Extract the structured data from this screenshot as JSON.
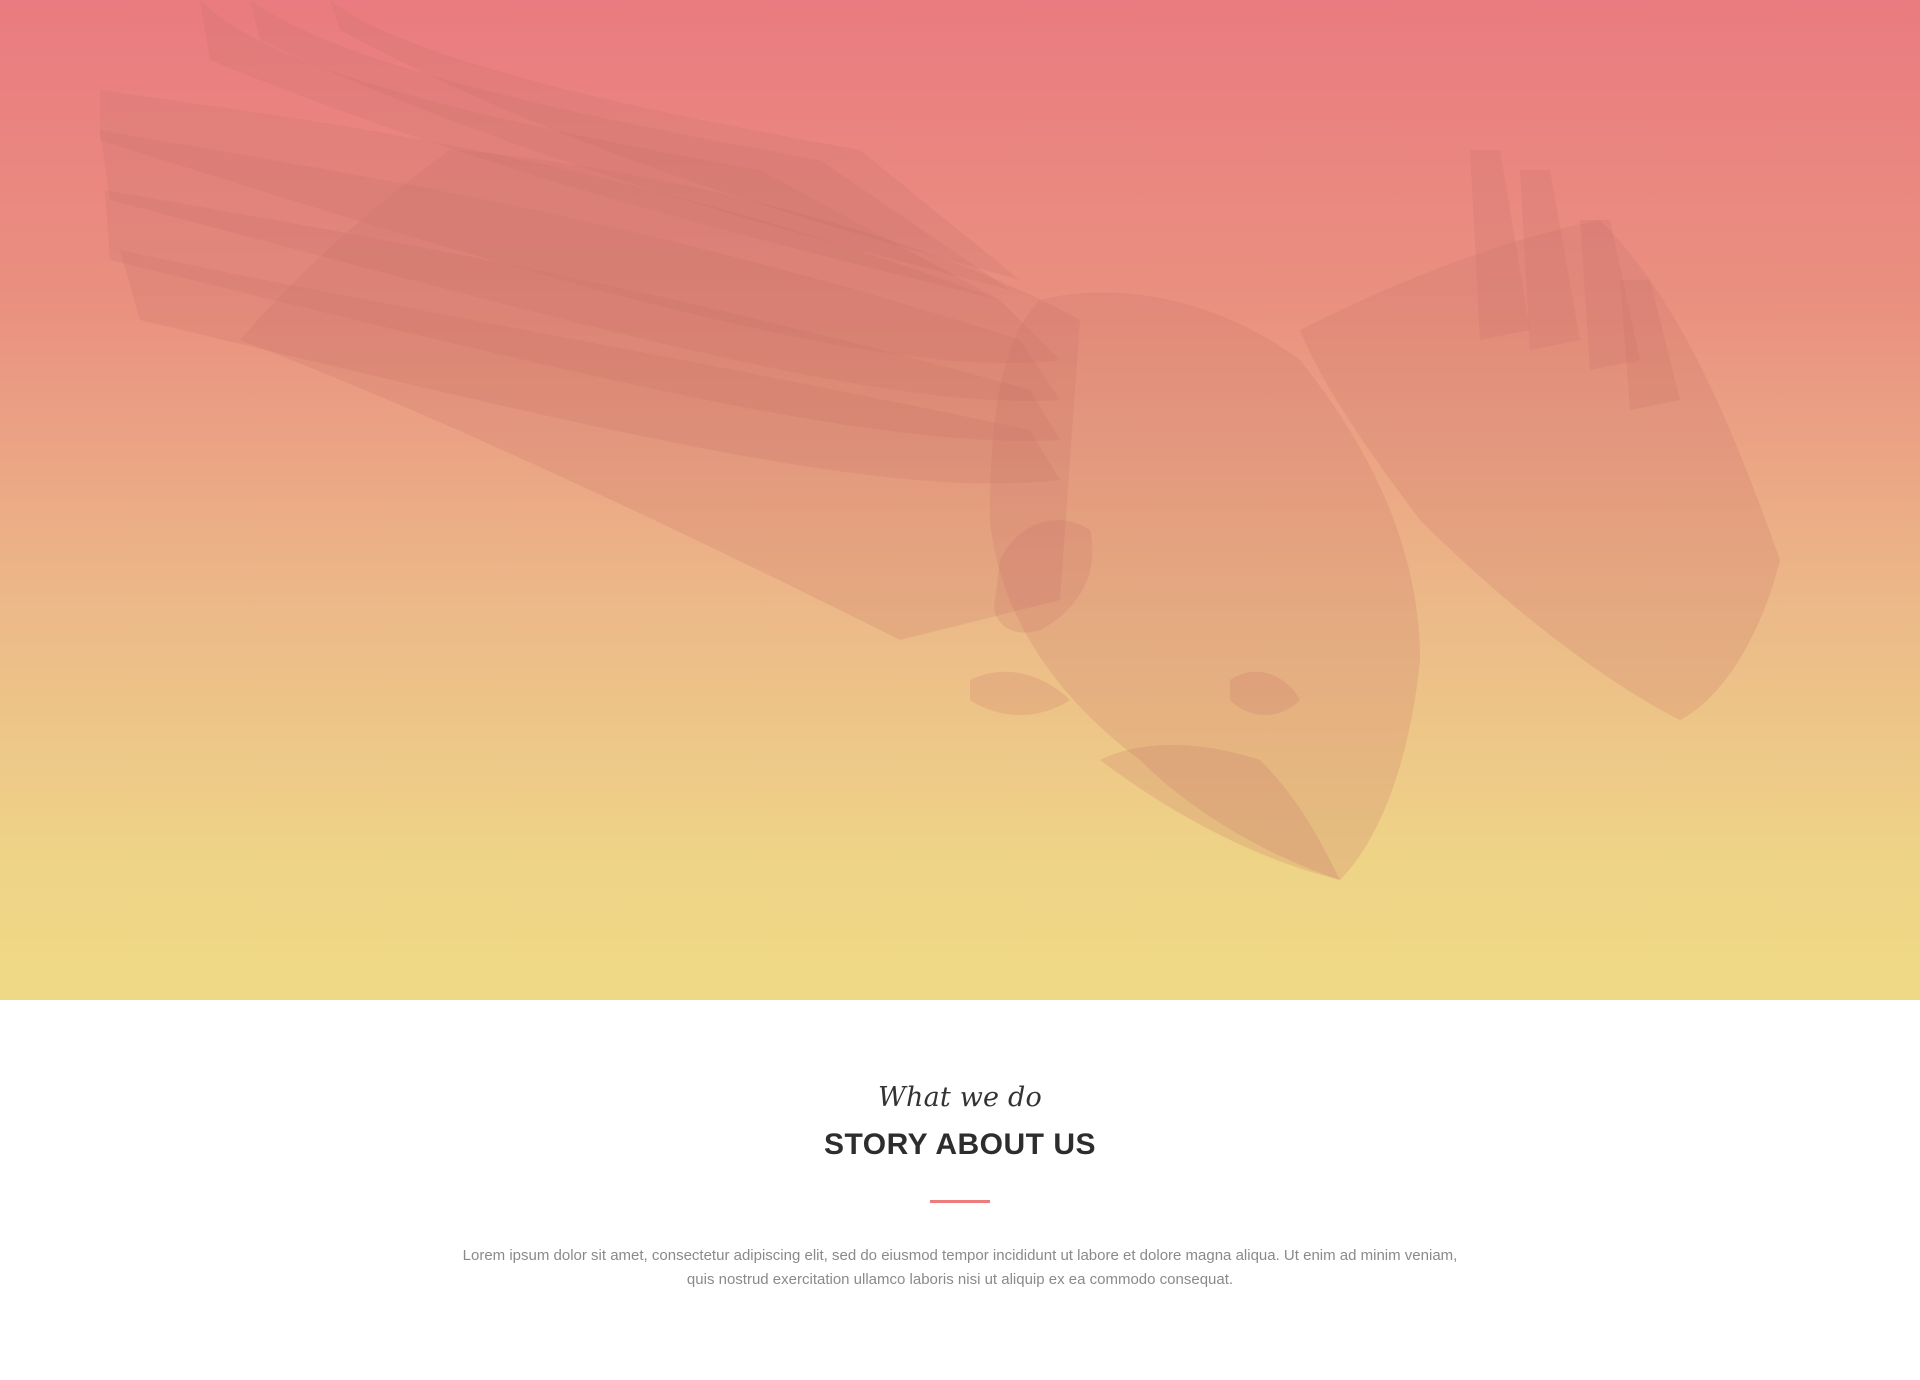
{
  "hero": {
    "image_icon": "eagle-illustration",
    "gradient_colors": [
      "#ea7b80",
      "#ecb888",
      "#efd986"
    ]
  },
  "about": {
    "kicker": "What we do",
    "title": "STORY ABOUT US",
    "divider_color": "#ef7c7c",
    "description": "Lorem ipsum dolor sit amet, consectetur adipiscing elit, sed do eiusmod tempor incididunt ut labore et dolore magna aliqua. Ut enim ad minim veniam, quis nostrud exercitation ullamco laboris nisi ut aliquip ex ea commodo consequat."
  }
}
